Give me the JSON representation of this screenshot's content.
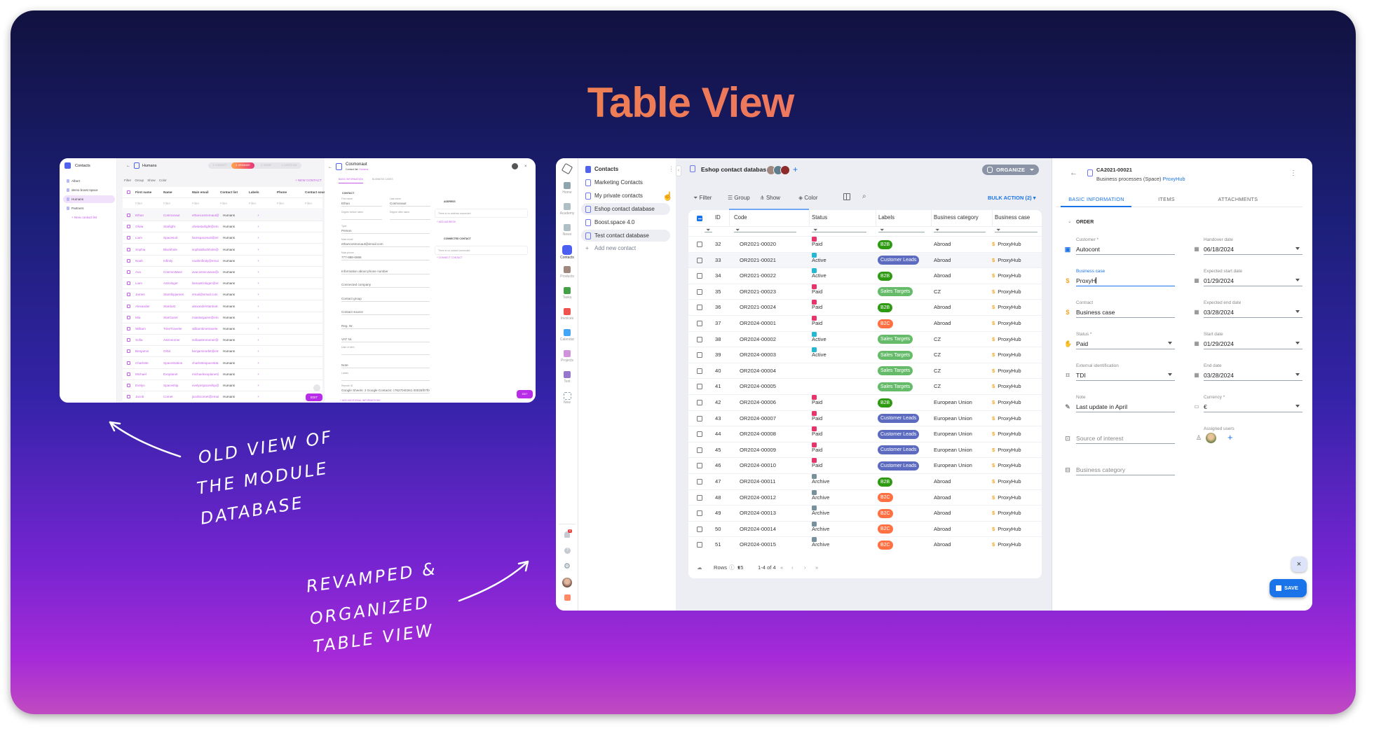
{
  "title": "Table View",
  "annotations": {
    "old": [
      "OLD VIEW OF",
      "THE MODULE",
      "DATABASE"
    ],
    "new": [
      "REVAMPED &",
      "ORGANIZED",
      "TABLE VIEW"
    ]
  },
  "old_view": {
    "sidebar": {
      "title": "Contacts",
      "items": [
        "Albert",
        "demo boost space automations",
        "Humans",
        "Partners"
      ],
      "add": "+ New contact list",
      "selected": 2
    },
    "header": {
      "title": "Humans",
      "steps": [
        "1. CONNECT",
        "2. ORGANIZE",
        "3. SHARE",
        "4. DATA FLOW"
      ],
      "active_step": 1
    },
    "toolbar": {
      "filter": "Filter",
      "group": "Group",
      "show": "Show",
      "color": "Color",
      "new_contact": "+ NEW CONTACT"
    },
    "columns": [
      "First name",
      "Name",
      "Main email",
      "Contact list",
      "Labels",
      "Phone",
      "Contact sourc"
    ],
    "filter_placeholder": "Filter",
    "rows": [
      [
        "Ethan",
        "Cosmonaut",
        "ethancosmonaut@...",
        "Humans"
      ],
      [
        "Olivia",
        "Starlight",
        "oliviastarlight@ema...",
        "Humans"
      ],
      [
        "Liam",
        "Spacesuit",
        "liamspacesuit@em...",
        "Humans"
      ],
      [
        "Sophia",
        "Blackhole",
        "sophiablackhole@e...",
        "Humans"
      ],
      [
        "Noah",
        "Infinity",
        "noahinfinity@email...",
        "Humans"
      ],
      [
        "Ava",
        "CosmicWave",
        "avacosmicwave@e...",
        "Humans"
      ],
      [
        "Liam",
        "Astrologer",
        "liamastrologer@em...",
        "Humans"
      ],
      [
        "James",
        "Starshipjames",
        "email@email.com",
        "Humans"
      ],
      [
        "Alexander",
        "Stardust",
        "alexanderstardust...",
        "Humans"
      ],
      [
        "Mia",
        "StarGazer",
        "miastargazer@ema...",
        "Humans"
      ],
      [
        "William",
        "TimeTraveler",
        "williamtimetravele...",
        "Humans"
      ],
      [
        "Sofia",
        "Astronomer",
        "sofiaastronomer@e...",
        "Humans"
      ],
      [
        "Benjamin",
        "Orbit",
        "benjaminorbit@em...",
        "Humans"
      ],
      [
        "Charlotte",
        "SpaceStation",
        "charlottespacestat...",
        "Humans"
      ],
      [
        "Michael",
        "Exoplanet",
        "michaelexoplanet@...",
        "Humans"
      ],
      [
        "Evelyn",
        "Spaceship",
        "evelynspaceship@e...",
        "Humans"
      ],
      [
        "Jacob",
        "Comet",
        "jacobcomet@email...",
        "Humans"
      ]
    ],
    "edit": "EDIT",
    "detail": {
      "title": "Cosmonaut",
      "subtitle_prefix": "Contact list:",
      "subtitle_link": "Humans",
      "tabs": [
        "BASIC INFORMATION",
        "BUSINESS CASES"
      ],
      "section": "CONTACT",
      "first_name_label": "First name",
      "first_name": "Ethan",
      "last_name_label": "Last name",
      "last_name": "Cosmonaut",
      "degree_before": "Degree before name",
      "degree_after": "Degree after name",
      "type_label": "Type",
      "type": "Person",
      "email_label": "Main email",
      "email": "ethancosmonaut@email.com",
      "phone_label": "Main phone",
      "phone": "777-888-6666",
      "empty_fields": [
        "Information about phone number",
        "Connected company",
        "Contact group",
        "Contact source",
        "Reg. Nr.",
        "VAT Nr."
      ],
      "dob_label": "Date of birth",
      "note": "Note",
      "labels_label": "Labels",
      "remote_label": "Remote ID",
      "remote": "Google Sheets: 2    Google Contacts: c7627040261 00025f07f0",
      "add_info": "+ ADD ADDITIONAL INFORMATIONS",
      "address_title": "ADDRESS",
      "address_empty": "There is no address connected",
      "add_address": "+ ADD ADDRESS",
      "connected_title": "CONNECTED CONTACT",
      "connected_empty": "There is no contact connected",
      "connect": "+ CONNECT CONTACT",
      "edit": "EDIT"
    }
  },
  "new_view": {
    "rail": [
      {
        "label": "Home",
        "icon": "home-icon",
        "color": "#90a4ae"
      },
      {
        "label": "Academy",
        "icon": "academy-icon",
        "color": "#b0bec5"
      },
      {
        "label": "News",
        "icon": "news-icon",
        "color": "#b0bec5"
      },
      {
        "label": "Contacts",
        "icon": "contacts-icon",
        "color": "#4c5ff0",
        "active": true
      },
      {
        "label": "Products",
        "icon": "products-icon",
        "color": "#a1887f"
      },
      {
        "label": "Tasks",
        "icon": "tasks-icon",
        "color": "#43a047"
      },
      {
        "label": "Invoices",
        "icon": "invoices-icon",
        "color": "#ef5350"
      },
      {
        "label": "Calendar",
        "icon": "calendar-icon",
        "color": "#42a5f5"
      },
      {
        "label": "Projects",
        "icon": "projects-icon",
        "color": "#ce93d8"
      },
      {
        "label": "Test",
        "icon": "test-icon",
        "color": "#9575cd"
      },
      {
        "label": "New",
        "icon": "plus-icon",
        "color": "#90a4ae"
      }
    ],
    "notification_count": "11",
    "sidebar": {
      "title": "Contacts",
      "items": [
        "Marketing Contacts",
        "My private contacts",
        "Eshop contact database",
        "Boost.space 4.0",
        "Test contact database"
      ],
      "selected": 2,
      "hovered": 4,
      "add": "Add new contact"
    },
    "header": {
      "title": "Eshop contact database",
      "organize": "ORGANIZE"
    },
    "toolbar": {
      "filter": "Filter",
      "group": "Group",
      "show": "Show",
      "color": "Color",
      "bulk": "BULK ACTION (2)"
    },
    "columns": [
      "ID",
      "Code",
      "Status",
      "Labels",
      "Business category",
      "Business case"
    ],
    "label_colors": {
      "B2B": "#2e9a12",
      "Customer Leads": "#5c6bc0",
      "Sales Targets": "#66bb6a",
      "B2C": "#ff7043"
    },
    "status_colors": {
      "Paid": "#e8336b",
      "Active": "#26b8d0",
      "Archive": "#78909c"
    },
    "rows": [
      {
        "id": "32",
        "code": "OR2021-00020",
        "status": "Paid",
        "label": "B2B",
        "category": "Abroad",
        "case": "ProxyHub"
      },
      {
        "id": "33",
        "code": "OR2021-00021",
        "status": "Active",
        "label": "Customer Leads",
        "category": "Abroad",
        "case": "ProxyHub",
        "highlight": true
      },
      {
        "id": "34",
        "code": "OR2021-00022",
        "status": "Active",
        "label": "B2B",
        "category": "Abroad",
        "case": "ProxyHub"
      },
      {
        "id": "35",
        "code": "OR2021-00023",
        "status": "Paid",
        "label": "Sales Targets",
        "category": "CZ",
        "case": "ProxyHub"
      },
      {
        "id": "36",
        "code": "OR2021-00024",
        "status": "Paid",
        "label": "B2B",
        "category": "Abroad",
        "case": "ProxyHub"
      },
      {
        "id": "37",
        "code": "OR2024-00001",
        "status": "Paid",
        "label": "B2C",
        "category": "Abroad",
        "case": "ProxyHub"
      },
      {
        "id": "38",
        "code": "OR2024-00002",
        "status": "Active",
        "label": "Sales Targets",
        "category": "CZ",
        "case": "ProxyHub"
      },
      {
        "id": "39",
        "code": "OR2024-00003",
        "status": "Active",
        "label": "Sales Targets",
        "category": "CZ",
        "case": "ProxyHub"
      },
      {
        "id": "40",
        "code": "OR2024-00004",
        "status": "",
        "label": "Sales Targets",
        "category": "CZ",
        "case": "ProxyHub"
      },
      {
        "id": "41",
        "code": "OR2024-00005",
        "status": "",
        "label": "Sales Targets",
        "category": "CZ",
        "case": "ProxyHub"
      },
      {
        "id": "42",
        "code": "OR2024-00006",
        "status": "Paid",
        "label": "B2B",
        "category": "European Union",
        "case": "ProxyHub"
      },
      {
        "id": "43",
        "code": "OR2024-00007",
        "status": "Paid",
        "label": "Customer Leads",
        "category": "European Union",
        "case": "ProxyHub"
      },
      {
        "id": "44",
        "code": "OR2024-00008",
        "status": "Paid",
        "label": "Customer Leads",
        "category": "European Union",
        "case": "ProxyHub"
      },
      {
        "id": "45",
        "code": "OR2024-00009",
        "status": "Paid",
        "label": "Customer Leads",
        "category": "European Union",
        "case": "ProxyHub"
      },
      {
        "id": "46",
        "code": "OR2024-00010",
        "status": "Paid",
        "label": "Customer Leads",
        "category": "European Union",
        "case": "ProxyHub"
      },
      {
        "id": "47",
        "code": "OR2024-00011",
        "status": "Archive",
        "label": "B2B",
        "category": "Abroad",
        "case": "ProxyHub"
      },
      {
        "id": "48",
        "code": "OR2024-00012",
        "status": "Archive",
        "label": "B2C",
        "category": "Abroad",
        "case": "ProxyHub"
      },
      {
        "id": "49",
        "code": "OR2024-00013",
        "status": "Archive",
        "label": "B2C",
        "category": "Abroad",
        "case": "ProxyHub"
      },
      {
        "id": "50",
        "code": "OR2024-00014",
        "status": "Archive",
        "label": "B2C",
        "category": "Abroad",
        "case": "ProxyHub"
      },
      {
        "id": "51",
        "code": "OR2024-00015",
        "status": "Archive",
        "label": "B2C",
        "category": "Abroad",
        "case": "ProxyHub"
      }
    ],
    "pager": {
      "rows_label": "Rows",
      "rows_value": "15",
      "range": "1-4 of 4"
    },
    "detail": {
      "code": "CA2021-00021",
      "subtitle": "Business processes (Space)",
      "subtitle_link": "ProxyHub",
      "tabs": [
        "BASIC INFORMATION",
        "ITEMS",
        "ATTACHMENTS"
      ],
      "active_tab": 0,
      "section": "ORDER",
      "left": [
        {
          "label": "Customer *",
          "value": "Autocont",
          "icon": "contact-card-icon"
        },
        {
          "label": "Business case",
          "value": "ProxyH",
          "icon": "dollar-icon",
          "focused": true
        },
        {
          "label": "Contract",
          "value": "Business case",
          "icon": "dollar-icon"
        },
        {
          "label": "Status *",
          "value": "Paid",
          "icon": "paid-hand-icon",
          "dropdown": true
        },
        {
          "label": "External identification",
          "value": "TDI",
          "icon": "bookmark-icon",
          "dropdown": true
        },
        {
          "label": "Note",
          "value": "Last update in April",
          "icon": "pencil-icon"
        },
        {
          "label": "",
          "placeholder": "Source of interest",
          "icon": "briefcase-icon"
        },
        {
          "label": "",
          "placeholder": "Business category",
          "icon": "category-icon"
        }
      ],
      "right": [
        {
          "label": "Handover date",
          "value": "06/18/2024"
        },
        {
          "label": "Expected start date",
          "value": "01/29/2024"
        },
        {
          "label": "Expected end date",
          "value": "03/28/2024"
        },
        {
          "label": "Start date",
          "value": "01/29/2024"
        },
        {
          "label": "End date",
          "value": "03/28/2024"
        },
        {
          "label": "Currency *",
          "value": "€"
        }
      ],
      "assigned_label": "Assigned users",
      "save": "SAVE"
    }
  }
}
